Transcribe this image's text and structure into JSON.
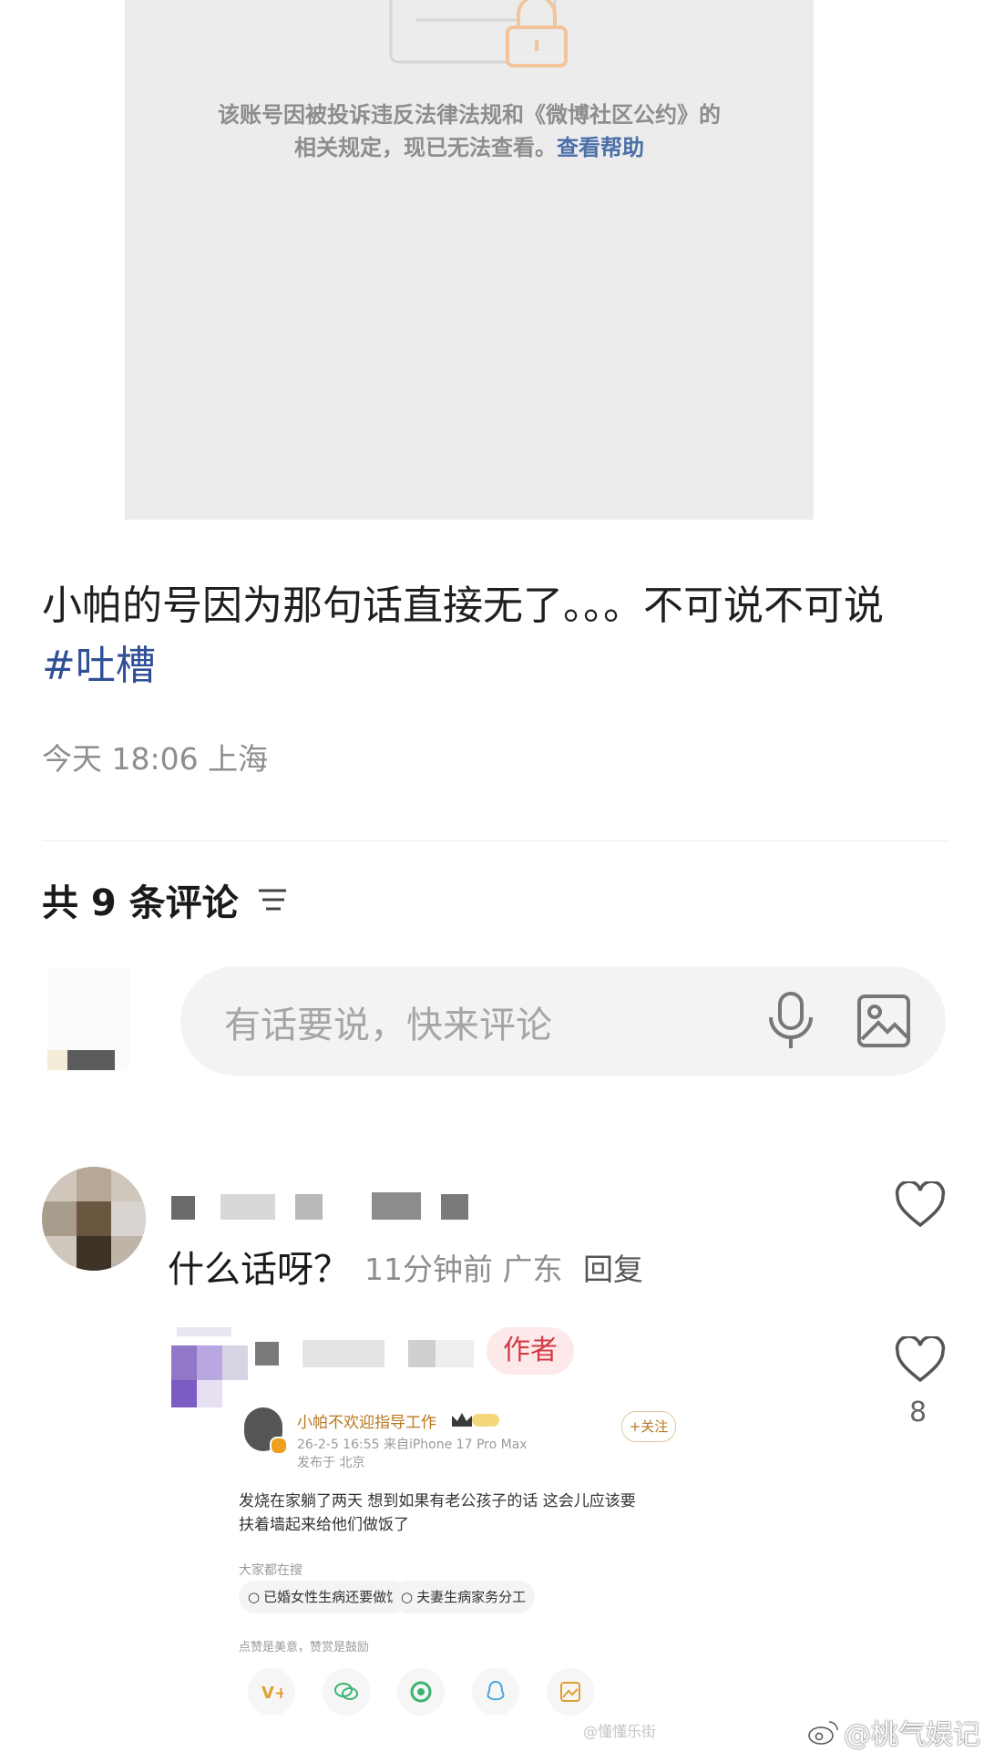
{
  "blocked": {
    "line1": "该账号因被投诉违反法律法规和《微博社区公约》的",
    "line2": "相关规定，现已无法查看。",
    "help_link": "查看帮助"
  },
  "post": {
    "text": "小帕的号因为那句话直接无了。。。不可说不可说",
    "hashtag": "#吐槽",
    "time": "今天 18:06",
    "location": "上海"
  },
  "comments_header": {
    "count_label": "共 9 条评论"
  },
  "composer": {
    "placeholder": "有话要说，快来评论",
    "mic_icon": "microphone-icon",
    "image_icon": "image-icon"
  },
  "comment1": {
    "text": "什么话呀？",
    "time": "11分钟前",
    "location": "广东",
    "reply": "回复"
  },
  "reply1": {
    "author_badge": "作者",
    "like_count": "8"
  },
  "embed": {
    "username": "小帕不欢迎指导工作",
    "follow": "+关注",
    "meta1": "26-2-5 16:55  来自iPhone 17 Pro Max",
    "meta2": "发布于 北京",
    "body1": "发烧在家躺了两天 想到如果有老公孩子的话 这会儿应该要",
    "body2": "扶着墙起来给他们做饭了",
    "search_label": "大家都在搜",
    "chip1": "已婚女性生病还要做饭",
    "chip2": "夫妻生病家务分工",
    "tip": "点赞是美意，赞赏是鼓励"
  },
  "watermark": {
    "small": "@懂懂乐街",
    "main": "@桃气娱记"
  },
  "colors": {
    "link": "#2f4f96",
    "author_badge_bg": "#fde9ea",
    "author_badge_text": "#d23a44"
  }
}
